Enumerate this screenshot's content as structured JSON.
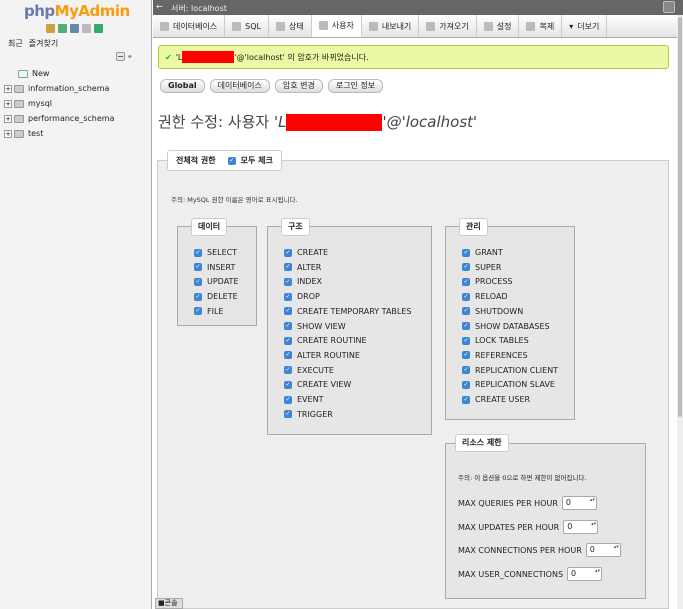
{
  "sidebar": {
    "logo_prefix": "php",
    "logo_suffix": "MyAdmin",
    "tab_recent": "최근",
    "tab_favorites": "즐겨찾기",
    "new_label": "New",
    "databases": [
      "information_schema",
      "mysql",
      "performance_schema",
      "test"
    ]
  },
  "topbar": {
    "server": "서버: localhost"
  },
  "menu": [
    "데이터베이스",
    "SQL",
    "상태",
    "사용자",
    "내보내기",
    "가져오기",
    "설정",
    "복제",
    "더보기"
  ],
  "message": {
    "prefix": "'L",
    "suffix": "'@'localhost' 의 암호가 바뀌었습니다."
  },
  "subtabs": [
    "Global",
    "데이터베이스",
    "암호 변경",
    "로그인 정보"
  ],
  "title": {
    "prefix": "권한 수정: 사용자 ",
    "user_start": "'L",
    "host": "'@'localhost'"
  },
  "global": {
    "legend": "전체적 권한",
    "check_all": "모두 체크",
    "note": "주의: MySQL 권한 이름은 영어로 표시됩니다.",
    "data": {
      "legend": "데이터",
      "items": [
        "SELECT",
        "INSERT",
        "UPDATE",
        "DELETE",
        "FILE"
      ]
    },
    "structure": {
      "legend": "구조",
      "items": [
        "CREATE",
        "ALTER",
        "INDEX",
        "DROP",
        "CREATE TEMPORARY TABLES",
        "SHOW VIEW",
        "CREATE ROUTINE",
        "ALTER ROUTINE",
        "EXECUTE",
        "CREATE VIEW",
        "EVENT",
        "TRIGGER"
      ]
    },
    "admin": {
      "legend": "관리",
      "items": [
        "GRANT",
        "SUPER",
        "PROCESS",
        "RELOAD",
        "SHUTDOWN",
        "SHOW DATABASES",
        "LOCK TABLES",
        "REFERENCES",
        "REPLICATION CLIENT",
        "REPLICATION SLAVE",
        "CREATE USER"
      ]
    }
  },
  "resources": {
    "legend": "리소스 제한",
    "note": "주의: 이 옵션을 0으로 하면 제한이 없어집니다.",
    "limits": [
      {
        "label": "MAX QUERIES PER HOUR",
        "value": "0"
      },
      {
        "label": "MAX UPDATES PER HOUR",
        "value": "0"
      },
      {
        "label": "MAX CONNECTIONS PER HOUR",
        "value": "0"
      },
      {
        "label": "MAX USER_CONNECTIONS",
        "value": "0"
      }
    ]
  },
  "console": "콘솔"
}
